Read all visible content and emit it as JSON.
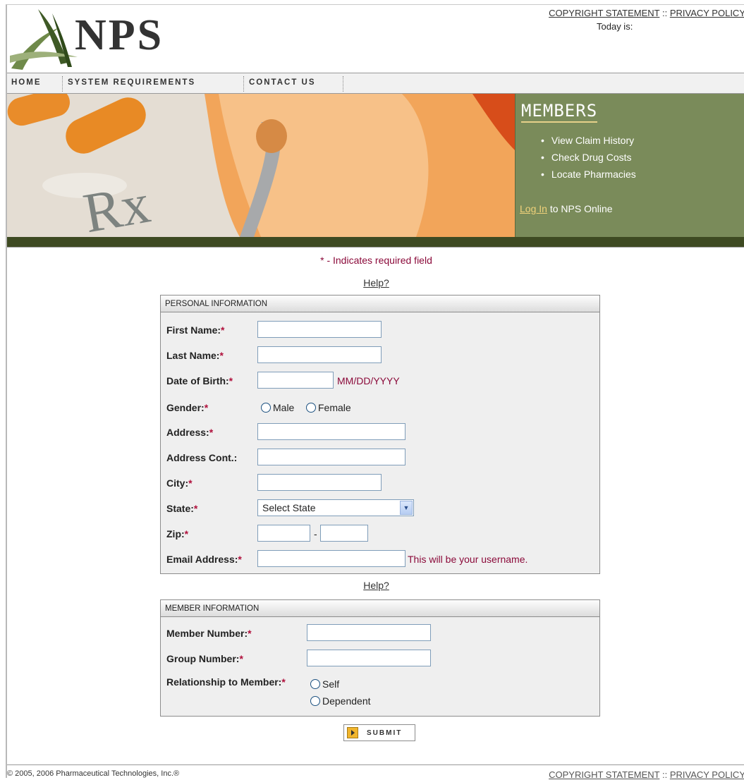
{
  "header": {
    "logo_text": "NPS",
    "copyright_link": "COPYRIGHT STATEMENT",
    "separator": "::",
    "privacy_link": "PRIVACY POLICY",
    "today_label": "Today is:"
  },
  "nav": {
    "items": [
      "HOME",
      "SYSTEM REQUIREMENTS",
      "CONTACT US"
    ]
  },
  "members": {
    "title": "MEMBERS",
    "bullets": [
      "View Claim History",
      "Check Drug Costs",
      "Locate Pharmacies"
    ],
    "login_link": "Log In",
    "login_suffix": "to NPS Online"
  },
  "form": {
    "required_note": "* - Indicates required field",
    "help_link": "Help?",
    "personal": {
      "title": "PERSONAL INFORMATION",
      "first_name": "First Name:",
      "last_name": "Last Name:",
      "dob": "Date of Birth:",
      "dob_hint": "MM/DD/YYYY",
      "gender": "Gender:",
      "male": "Male",
      "female": "Female",
      "address": "Address:",
      "address_cont": "Address Cont.:",
      "city": "City:",
      "state": "State:",
      "state_value": "Select State",
      "zip": "Zip:",
      "zip_dash": "-",
      "email": "Email Address:",
      "email_hint": "This will be your username."
    },
    "member": {
      "title": "MEMBER INFORMATION",
      "member_number": "Member Number:",
      "group_number": "Group Number:",
      "relationship": "Relationship to Member:",
      "self": "Self",
      "dependent": "Dependent"
    },
    "required_star": "*",
    "submit_label": "SUBMIT"
  },
  "footer": {
    "copyright": "© 2005, 2006 Pharmaceutical Technologies, Inc.®",
    "copyright_link": "COPYRIGHT STATEMENT",
    "separator": "::",
    "privacy_link": "PRIVACY POLICY"
  }
}
